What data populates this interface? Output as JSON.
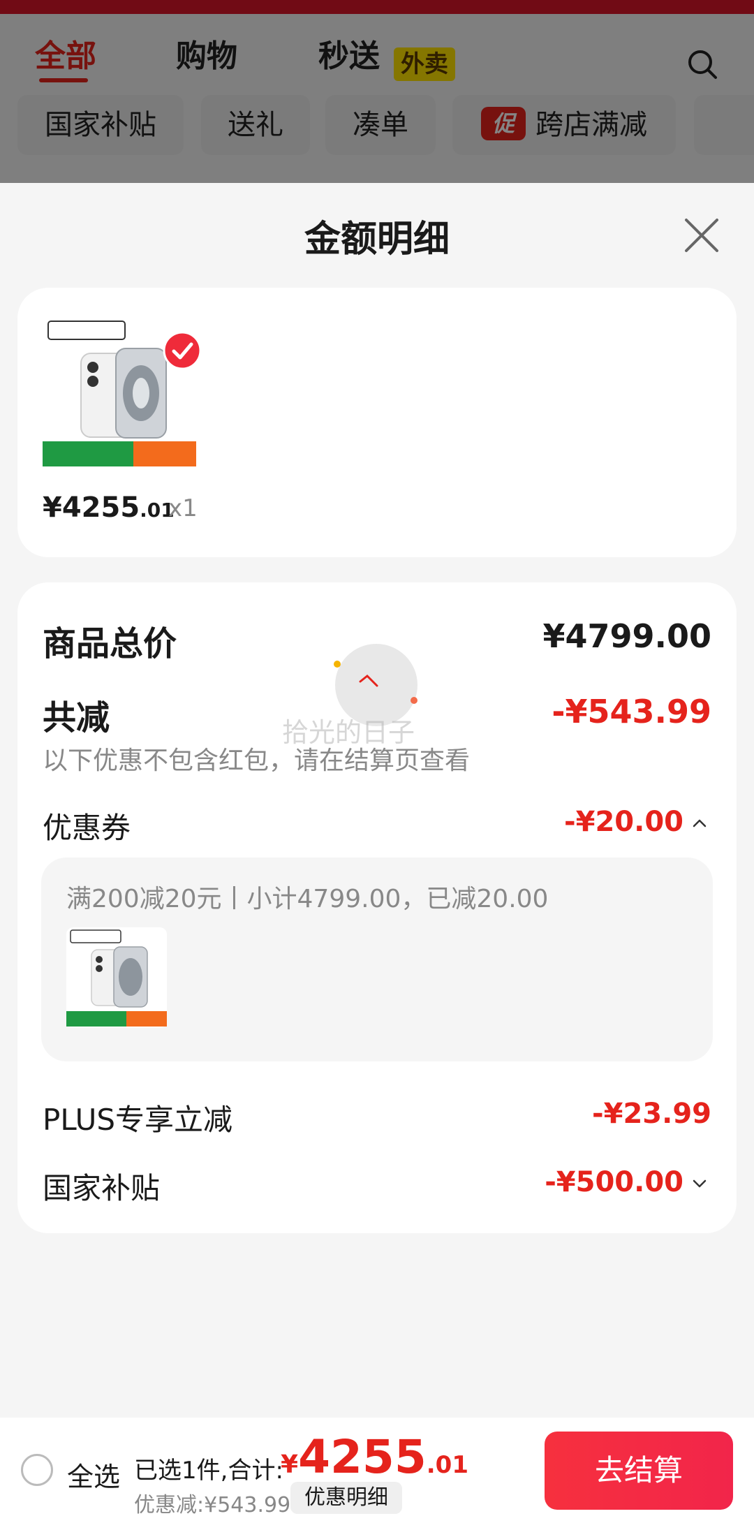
{
  "background": {
    "tabs": [
      "全部",
      "购物",
      "秒送"
    ],
    "takeout_badge": "外卖",
    "chips": [
      "国家补贴",
      "送礼",
      "凑单",
      "跨店满减"
    ],
    "promo_badge": "促"
  },
  "sheet": {
    "title": "金额明细",
    "product": {
      "price_int": "¥4255",
      "price_dec": ".01",
      "qty": "x1"
    },
    "total_label": "商品总价",
    "total_value": "¥4799.00",
    "reduce_label": "共减",
    "reduce_value": "-¥543.99",
    "note": "以下优惠不包含红包，请在结算页查看",
    "coupon_label": "优惠券",
    "coupon_value": "-¥20.00",
    "coupon_detail": "满200减20元丨小计4799.00，已减20.00",
    "plus_label": "PLUS专享立减",
    "plus_value": "-¥23.99",
    "subsidy_label": "国家补贴",
    "subsidy_value": "-¥500.00",
    "watermark": "拾光的日子"
  },
  "bottom_bar": {
    "select_all": "全选",
    "selected_text": "已选1件,合计:",
    "total_symbol": "¥",
    "total_int": "4255",
    "total_dec": ".01",
    "discount_text": "优惠减:¥543.99",
    "detail_button": "优惠明细",
    "checkout_button": "去结算"
  },
  "colors": {
    "accent": "#e5231c",
    "badge_yellow": "#ffe300"
  }
}
